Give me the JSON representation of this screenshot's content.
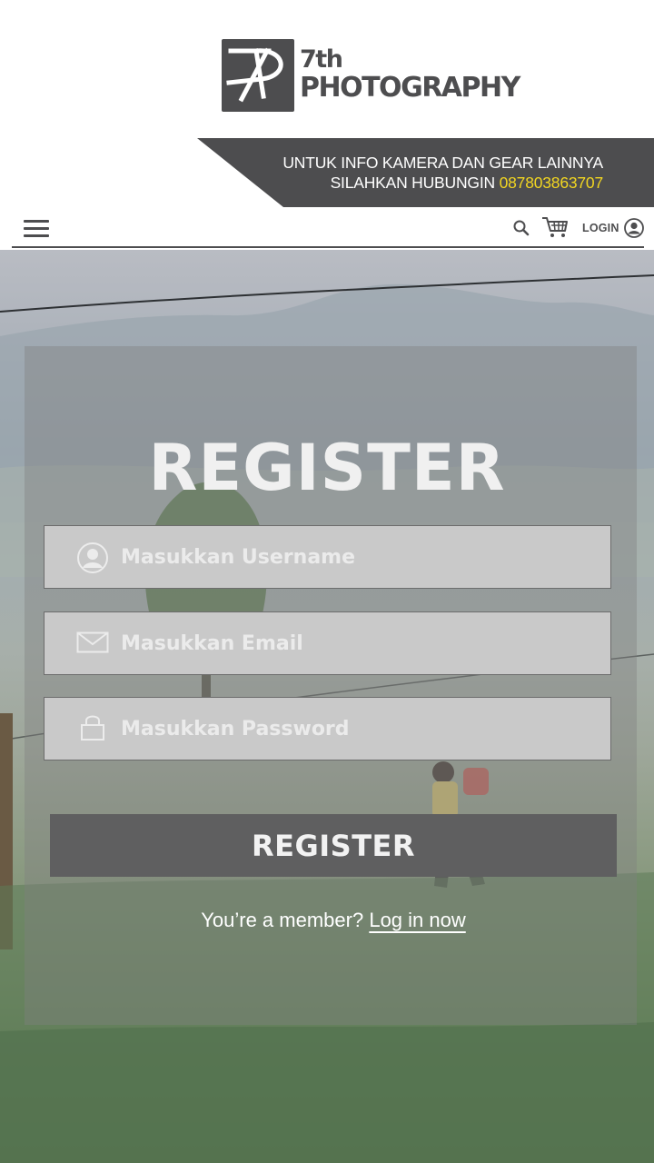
{
  "brand": {
    "line1": "7th",
    "line2": "PHOTOGRAPHY"
  },
  "banner": {
    "line1": "UNTUK INFO KAMERA DAN GEAR LAINNYA",
    "line2_prefix": "SILAHKAN HUBUNGIN ",
    "phone": "087803863707",
    "phone_color": "#f2d621",
    "bg_color": "#4d4d4f"
  },
  "nav": {
    "menu_icon": "hamburger-menu-icon",
    "search_icon": "search-icon",
    "cart_icon": "cart-icon",
    "login_label": "LOGIN",
    "login_icon": "user-circle-icon"
  },
  "register": {
    "title": "REGISTER",
    "username_placeholder": "Masukkan Username",
    "email_placeholder": "Masukkan Email",
    "password_placeholder": "Masukkan Password",
    "button_label": "REGISTER",
    "member_text": "You’re a member?",
    "login_link": "Log in now"
  }
}
